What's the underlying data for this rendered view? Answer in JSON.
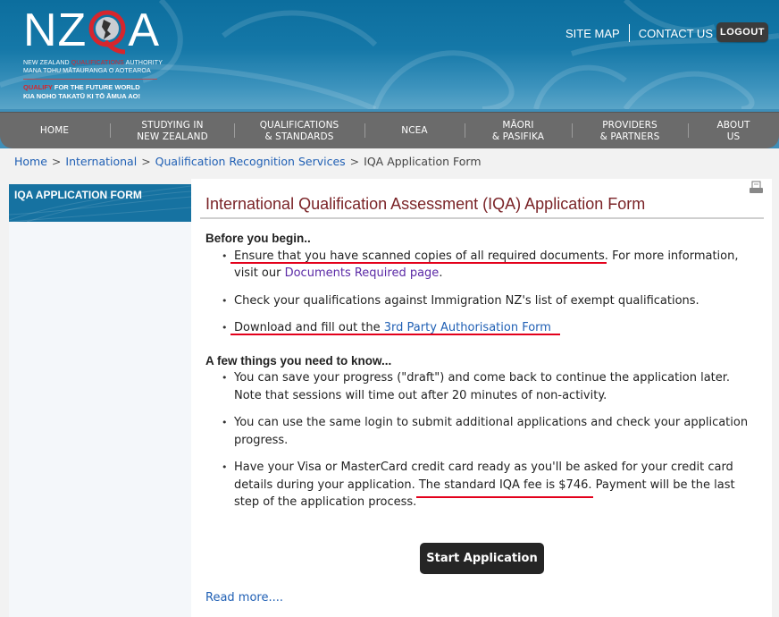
{
  "header": {
    "logo": {
      "letters_left": "NZ",
      "letter_q": "Q",
      "letters_right": "A",
      "line1_part1": "NEW ZEALAND ",
      "line1_red": "QUALIFICATIONS",
      "line1_part2": " AUTHORITY",
      "line2": "MANA TOHU MĀTAURANGA O AOTEAROA",
      "tagline_red": "QUALIFY",
      "tagline_rest": " FOR THE FUTURE WORLD",
      "tagline2": "KIA NOHO TAKATŪ KI TŌ ĀMUA AO!"
    },
    "site_map": "SITE MAP",
    "contact_us": "CONTACT US",
    "logout": "LOGOUT"
  },
  "nav": {
    "items": [
      {
        "line1": "HOME",
        "line2": ""
      },
      {
        "line1": "STUDYING IN",
        "line2": "NEW ZEALAND"
      },
      {
        "line1": "QUALIFICATIONS",
        "line2": "& STANDARDS"
      },
      {
        "line1": "NCEA",
        "line2": ""
      },
      {
        "line1": "MĀORI",
        "line2": "& PASIFIKA"
      },
      {
        "line1": "PROVIDERS",
        "line2": "& PARTNERS"
      },
      {
        "line1": "ABOUT",
        "line2": "US"
      }
    ]
  },
  "breadcrumb": {
    "items": [
      "Home",
      "International",
      "Qualification Recognition Services"
    ],
    "current": "IQA Application Form",
    "separator": ">"
  },
  "sidebar": {
    "heading": "IQA APPLICATION FORM"
  },
  "main": {
    "title": "International Qualification Assessment (IQA) Application Form",
    "before_heading": "Before you begin..",
    "before_items": {
      "item1_text": "Ensure that you have scanned copies of all required documents.",
      "item1_more": " For more information, visit our ",
      "item1_link": "Documents Required page",
      "item1_end": ".",
      "item2_text": "Check your qualifications against Immigration NZ's list of exempt qualifications.",
      "item3_text": "Download and fill out the ",
      "item3_link": "3rd Party Authorisation Form"
    },
    "know_heading": "A few things you need to know...",
    "know_items": {
      "item1": "You can save your progress (\"draft\") and come back to continue the application later. Note that sessions will time out after 20 minutes of non-activity.",
      "item2": "You can use the same login to submit additional applications and check your application progress.",
      "item3_pre": "Have your Visa or MasterCard credit card ready as you'll be asked for your credit card details during your application. ",
      "item3_fee": "The standard IQA fee is $746.",
      "item3_post": " Payment will be the last step of the application process."
    },
    "start_button": "Start Application",
    "read_more": "Read more...."
  },
  "colors": {
    "header_blue": "#0c6e9e",
    "nav_gray": "#6b6b6b",
    "title_maroon": "#7a2327",
    "link_blue": "#1f5fb4",
    "annotation_red": "#e3001b"
  }
}
